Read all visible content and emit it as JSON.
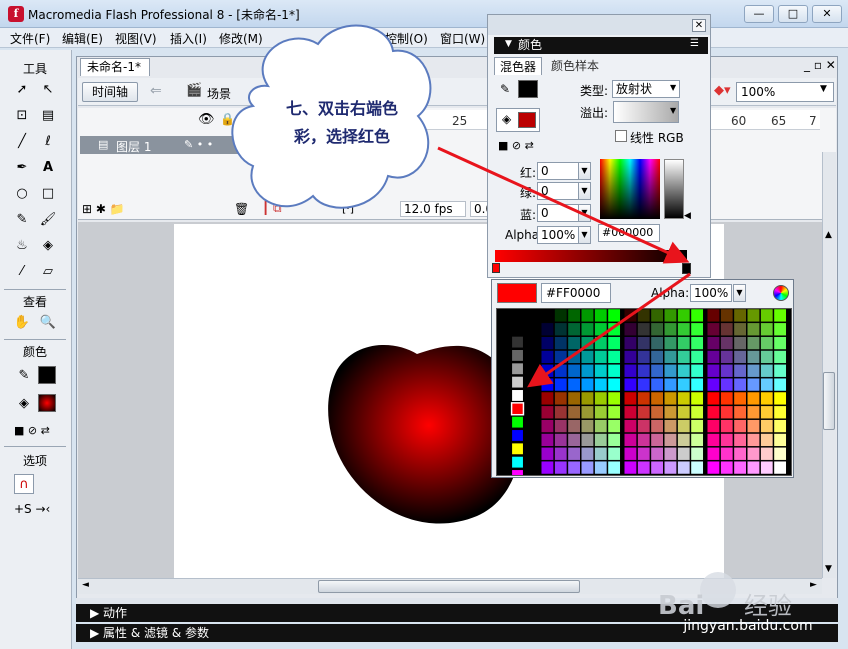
{
  "window": {
    "title": "Macromedia Flash Professional 8 - [未命名-1*]",
    "buttons": {
      "minimize": "—",
      "maximize": "□",
      "close": "✕"
    }
  },
  "menubar": [
    "文件(F)",
    "编辑(E)",
    "视图(V)",
    "插入(I)",
    "修改(M)",
    "控制(O)",
    "窗口(W)"
  ],
  "tools": {
    "header": "工具",
    "view_header": "查看",
    "color_header": "颜色",
    "options_header": "选项"
  },
  "document": {
    "tab": "未命名-1*",
    "timeline_button": "时间轴",
    "scene_label": "场景",
    "layer_name": "图层 1",
    "fps": "12.0 fps",
    "time": "0.0",
    "frame_numbers": [
      "25",
      "60",
      "65",
      "7"
    ],
    "zoom": "100%"
  },
  "mixer": {
    "title": "颜色",
    "tabs": [
      "混色器",
      "颜色样本"
    ],
    "type_label": "类型:",
    "type_value": "放射状",
    "overflow_label": "溢出:",
    "linear_rgb_label": "线性 RGB",
    "red_label": "红:",
    "red_value": "0",
    "green_label": "绿:",
    "green_value": "0",
    "blue_label": "蓝:",
    "blue_value": "0",
    "alpha_label": "Alpha:",
    "alpha_value": "100%",
    "hex_value": "#000000",
    "gradient_colors": [
      "#FF0000",
      "#000000"
    ]
  },
  "swatch_popup": {
    "hex_value": "#FF0000",
    "alpha_label": "Alpha:",
    "alpha_value": "100%",
    "selected_color": "#FF0000"
  },
  "callout": {
    "line1": "七、双击右端色",
    "line2": "彩，选择红色"
  },
  "bottom_panels": [
    "动作",
    "属性 & 滤镜 & 参数"
  ],
  "watermark": {
    "brand_en": "Baidu",
    "brand_cn": "经验",
    "url": "jingyan.baidu.com"
  }
}
